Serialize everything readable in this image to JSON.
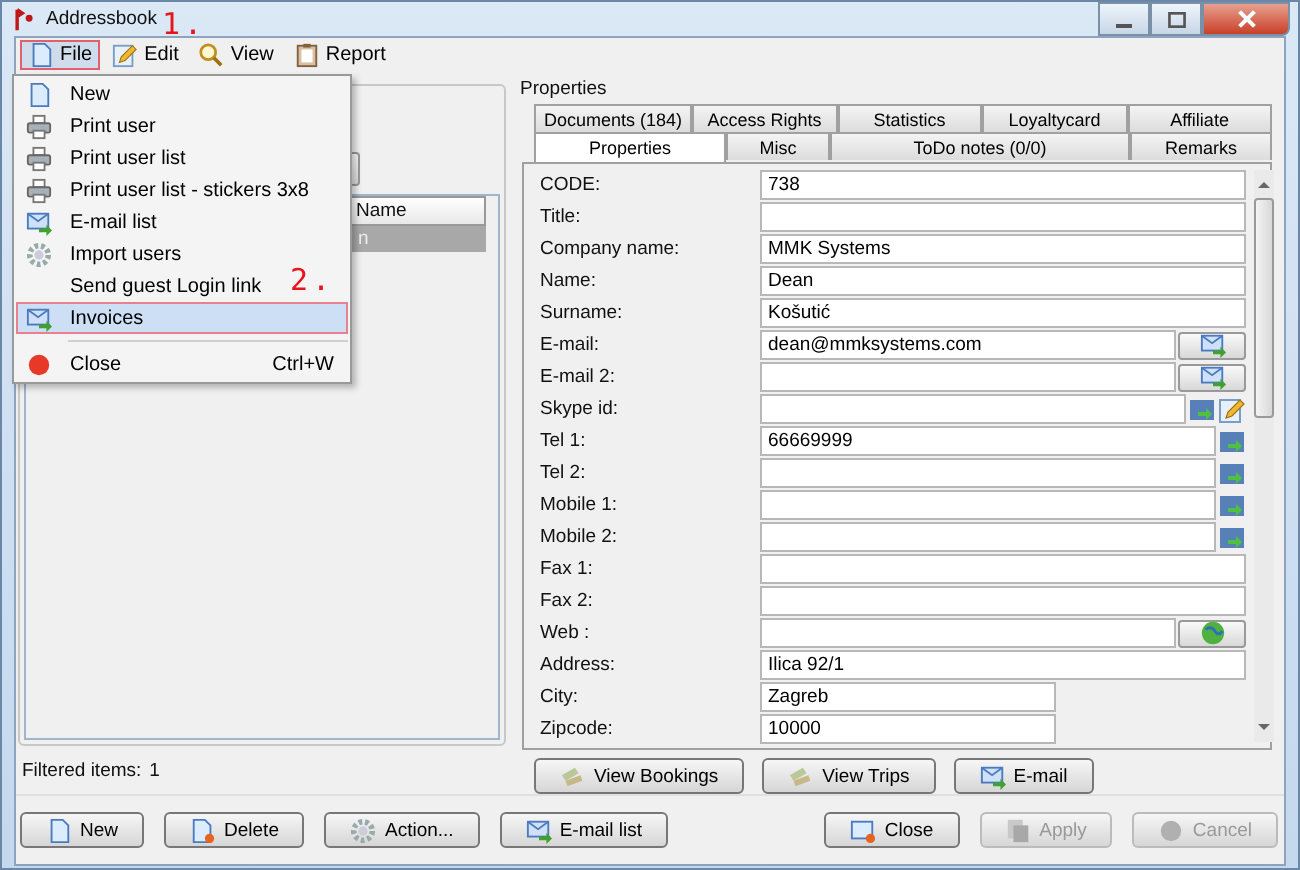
{
  "window": {
    "title": "Addressbook"
  },
  "menubar": [
    {
      "label": "File",
      "kind": "doc",
      "selected": true
    },
    {
      "label": "Edit",
      "kind": "pencil",
      "selected": false
    },
    {
      "label": "View",
      "kind": "magnifier",
      "selected": false
    },
    {
      "label": "Report",
      "kind": "clipboard",
      "selected": false
    }
  ],
  "file_menu": [
    {
      "label": "New",
      "kind": "doc",
      "selected": false
    },
    {
      "label": "Print user",
      "kind": "printer",
      "selected": false
    },
    {
      "label": "Print user list",
      "kind": "printer",
      "selected": false
    },
    {
      "label": "Print user list - stickers 3x8",
      "kind": "printer",
      "selected": false
    },
    {
      "label": "E-mail list",
      "kind": "mail",
      "selected": false
    },
    {
      "label": "Import users",
      "kind": "gear",
      "selected": false
    },
    {
      "label": "Send guest Login link",
      "kind": "plain",
      "selected": false
    },
    {
      "label": "Invoices",
      "kind": "mail",
      "selected": true
    },
    {
      "kind": "separator"
    },
    {
      "label": "Close",
      "kind": "red-dot",
      "shortcut": "Ctrl+W",
      "selected": false
    }
  ],
  "annotations": [
    "1.",
    "2."
  ],
  "user_list": {
    "columns": [
      "Name"
    ],
    "rows": [
      {
        "cells": [
          "n"
        ],
        "selected": true
      }
    ],
    "filtered_label": "Filtered items:",
    "filtered_count": "1"
  },
  "properties": {
    "title": "Properties",
    "tabs_back": [
      {
        "label": "Documents (184)",
        "selected": false
      },
      {
        "label": "Access Rights",
        "selected": false
      },
      {
        "label": "Statistics",
        "selected": false
      },
      {
        "label": "Loyaltycard",
        "selected": false
      },
      {
        "label": "Affiliate",
        "selected": false
      }
    ],
    "tabs_front": [
      {
        "label": "Properties",
        "selected": true
      },
      {
        "label": "Misc",
        "selected": false
      },
      {
        "label": "ToDo notes (0/0)",
        "selected": false
      },
      {
        "label": "Remarks",
        "selected": false
      }
    ],
    "fields": [
      {
        "label": "CODE:",
        "value": "738",
        "kind": "plain"
      },
      {
        "label": "Title:",
        "kind": "plain"
      },
      {
        "label": "Company name:",
        "value": "MMK Systems",
        "kind": "plain"
      },
      {
        "label": "Name:",
        "value": "Dean",
        "kind": "plain"
      },
      {
        "label": "Surname:",
        "value": "Košutić",
        "kind": "plain"
      },
      {
        "label": "E-mail:",
        "value": "dean@mmksystems.com",
        "kind": "email"
      },
      {
        "label": "E-mail 2:",
        "kind": "email"
      },
      {
        "label": "Skype id:",
        "kind": "skype"
      },
      {
        "label": "Tel 1:",
        "value": "66669999",
        "kind": "phone"
      },
      {
        "label": "Tel 2:",
        "kind": "phone"
      },
      {
        "label": "Mobile 1:",
        "kind": "phone"
      },
      {
        "label": "Mobile 2:",
        "kind": "phone"
      },
      {
        "label": "Fax 1:",
        "kind": "plain"
      },
      {
        "label": "Fax 2:",
        "kind": "plain"
      },
      {
        "label": "Web :",
        "kind": "web"
      },
      {
        "label": "Address:",
        "value": "Ilica 92/1",
        "kind": "plain"
      },
      {
        "label": "City:",
        "value": "Zagreb",
        "kind": "short"
      },
      {
        "label": "Zipcode:",
        "value": "10000",
        "kind": "short"
      }
    ],
    "buttons": [
      {
        "label": "View Bookings",
        "kind": "tickets"
      },
      {
        "label": "View Trips",
        "kind": "tickets"
      },
      {
        "label": "E-mail",
        "kind": "mail"
      }
    ]
  },
  "footer_left": [
    {
      "label": "New",
      "kind": "doc",
      "disabled": false
    },
    {
      "label": "Delete",
      "kind": "doc-delete",
      "disabled": false
    },
    {
      "label": "Action...",
      "kind": "gear",
      "disabled": false
    },
    {
      "label": "E-mail list",
      "kind": "mail",
      "disabled": false
    }
  ],
  "footer_right": [
    {
      "label": "Close",
      "kind": "window-close",
      "disabled": false
    },
    {
      "label": "Apply",
      "kind": "pages",
      "disabled": true
    },
    {
      "label": "Cancel",
      "kind": "grey-dot",
      "disabled": true
    }
  ]
}
